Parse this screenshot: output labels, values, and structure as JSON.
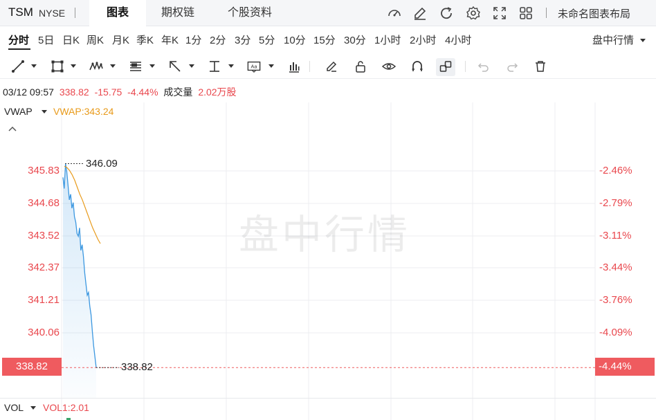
{
  "header": {
    "symbol": "TSM",
    "exchange": "NYSE",
    "tabs": [
      {
        "label": "图表",
        "active": true
      },
      {
        "label": "期权链",
        "active": false
      },
      {
        "label": "个股资料",
        "active": false
      }
    ],
    "toolbar_icons": [
      "gauge-icon",
      "edit-icon",
      "refresh-icon",
      "settings-icon",
      "fullscreen-icon",
      "grid-layout-icon"
    ],
    "layout_name": "未命名图表布局"
  },
  "periods": {
    "items": [
      "分时",
      "5日",
      "日K",
      "周K",
      "月K",
      "季K",
      "年K",
      "1分",
      "2分",
      "3分",
      "5分",
      "10分",
      "15分",
      "30分",
      "1小时",
      "2小时",
      "4小时"
    ],
    "active": "分时",
    "session_label": "盘中行情"
  },
  "draw_tools": [
    "line-tool-icon",
    "rect-tool-icon",
    "pattern-tool-icon",
    "fib-tool-icon",
    "arrow-tool-icon",
    "measure-tool-icon",
    "text-tool-icon",
    "indicator-icon",
    "pencil-icon",
    "lock-icon",
    "eye-icon",
    "magnet-icon",
    "link-icon",
    "undo-icon",
    "redo-icon",
    "trash-icon"
  ],
  "info": {
    "datetime": "03/12 09:57",
    "price": "338.82",
    "change": "-15.75",
    "change_pct": "-4.44%",
    "volume_label": "成交量",
    "volume_value": "2.02万股"
  },
  "vwap": {
    "label": "VWAP",
    "value_text": "VWAP:343.24"
  },
  "watermark": "盘中行情",
  "colors": {
    "down": "#e9474d",
    "price_line": "#3b97e0",
    "vwap_line": "#e89a1a",
    "tag_bg": "#ef5b5f"
  },
  "chart_data": {
    "type": "line",
    "y_ticks_left": [
      "345.83",
      "344.68",
      "343.52",
      "342.37",
      "341.21",
      "340.06"
    ],
    "y_ticks_right": [
      "-2.46%",
      "-2.79%",
      "-3.11%",
      "-3.44%",
      "-3.76%",
      "-4.09%"
    ],
    "ylim": [
      338.3,
      346.8
    ],
    "high_label": "346.09",
    "current_label": "338.82",
    "current_pct_label": "-4.44%",
    "series": [
      {
        "name": "price",
        "values": [
          345.6,
          345.2,
          346.09,
          345.8,
          345.3,
          344.8,
          345.0,
          344.5,
          344.7,
          344.2,
          344.0,
          343.6,
          343.5,
          343.8,
          343.0,
          343.2,
          342.8,
          342.2,
          341.8,
          341.4,
          341.5,
          341.0,
          340.7,
          340.1,
          339.6,
          339.2,
          338.82
        ],
        "color": "#3b97e0"
      },
      {
        "name": "VWAP",
        "values": [
          346.0,
          345.95,
          345.85,
          345.7,
          345.5,
          345.25,
          345.0,
          344.8,
          344.55,
          344.3,
          344.05,
          343.8,
          343.6,
          343.4,
          343.24
        ],
        "color": "#e89a1a"
      }
    ]
  },
  "volume": {
    "label": "VOL",
    "value_text": "VOL1:2.01"
  }
}
